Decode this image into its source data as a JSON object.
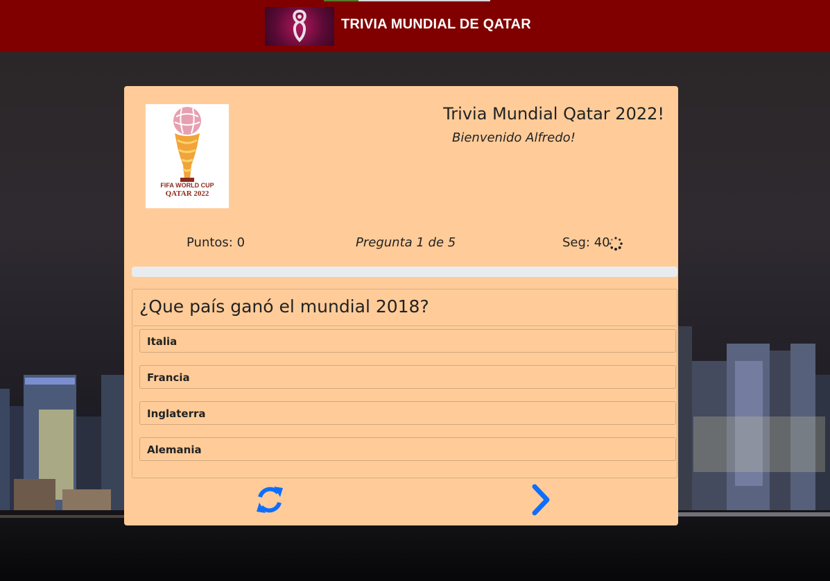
{
  "navbar": {
    "title": "TRIVIA MUNDIAL DE QATAR",
    "brand_icon": "qatar-2022-emblem"
  },
  "card": {
    "logo": {
      "icon": "fifa-world-cup-trophy",
      "line1": "FIFA WORLD CUP",
      "line2": "QATAR 2022"
    },
    "title": "Trivia Mundial Qatar 2022!",
    "welcome": "Bienvenido Alfredo!",
    "stats": {
      "points": "Puntos: 0",
      "question_counter": "Pregunta 1 de 5",
      "timer": "Seg: 40"
    },
    "progress_fraction": 0,
    "question": "¿Que país ganó el mundial 2018?",
    "answers": [
      "Italia",
      "Francia",
      "Inglaterra",
      "Alemania"
    ],
    "buttons": {
      "restart_icon": "refresh-icon",
      "next_icon": "chevron-right-icon"
    }
  },
  "colors": {
    "navbar": "#800000",
    "card": "#ffcc99",
    "accent": "#0d6efd"
  }
}
